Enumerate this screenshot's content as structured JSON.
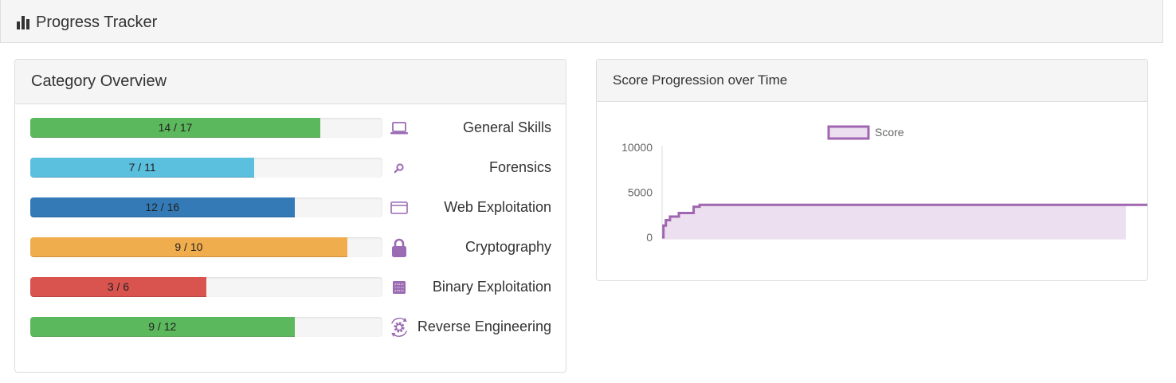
{
  "header": {
    "title": "Progress Tracker",
    "icon": "bar-chart-icon"
  },
  "category_panel": {
    "title": "Category Overview",
    "categories": [
      {
        "name": "General Skills",
        "progress": "14 / 17",
        "solved": 14,
        "total": 17,
        "color": "#5cb85c",
        "icon": "laptop-icon"
      },
      {
        "name": "Forensics",
        "progress": "7 / 11",
        "solved": 7,
        "total": 11,
        "color": "#5bc0de",
        "icon": "search-icon"
      },
      {
        "name": "Web Exploitation",
        "progress": "12 / 16",
        "solved": 12,
        "total": 16,
        "color": "#337ab7",
        "icon": "browser-window-icon"
      },
      {
        "name": "Cryptography",
        "progress": "9 / 10",
        "solved": 9,
        "total": 10,
        "color": "#f0ad4e",
        "icon": "lock-icon"
      },
      {
        "name": "Binary Exploitation",
        "progress": "3 / 6",
        "solved": 3,
        "total": 6,
        "color": "#d9534f",
        "icon": "binary-icon"
      },
      {
        "name": "Reverse Engineering",
        "progress": "9 / 12",
        "solved": 9,
        "total": 12,
        "color": "#5cb85c",
        "icon": "gear-cycle-icon"
      }
    ]
  },
  "score_panel": {
    "title": "Score Progression over Time"
  },
  "chart_data": {
    "type": "area",
    "title": "",
    "xlabel": "",
    "ylabel": "",
    "y_ticks": [
      "0",
      "5000",
      "10000"
    ],
    "ylim": [
      0,
      10000
    ],
    "xlim": [
      0,
      100
    ],
    "grid": false,
    "legend": "top",
    "line_color": "#a066b0",
    "fill_color": "#ebdff0",
    "series": [
      {
        "name": "Score",
        "x": [
          0,
          0.3,
          0.8,
          1.7,
          3.6,
          6.2,
          6.8,
          8.1,
          131,
          15.6,
          19.8,
          26.7,
          33.7,
          37.7,
          44.9,
          49.7,
          57.3,
          60.2,
          62.8,
          69.2,
          73.8,
          75,
          78,
          79.3,
          81.3,
          85.3,
          88.8,
          93,
          100
        ],
        "y": [
          0,
          1300,
          1900,
          2300,
          2700,
          2700,
          3400,
          3600,
          3600,
          3600,
          3600,
          3600,
          3600,
          3600,
          3600,
          3600,
          3600,
          3600,
          3600,
          3600,
          3600,
          3600,
          3600,
          3600,
          3600,
          3600,
          3600,
          3600,
          3600
        ]
      }
    ]
  }
}
